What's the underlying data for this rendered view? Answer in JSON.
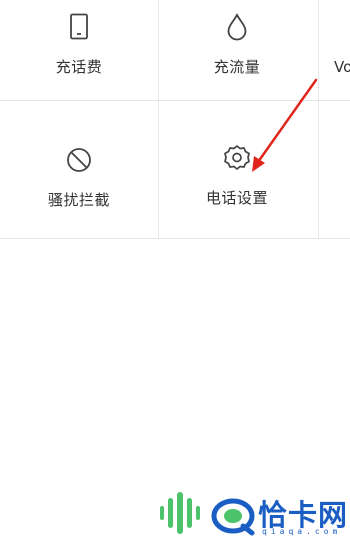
{
  "grid": {
    "row1": [
      {
        "label": "充话费",
        "icon": "phone-outline-icon"
      },
      {
        "label": "充流量",
        "icon": "droplet-icon"
      },
      {
        "label": "Vo",
        "icon": ""
      }
    ],
    "row2": [
      {
        "label": "骚扰拦截",
        "icon": "block-icon"
      },
      {
        "label": "电话设置",
        "icon": "gear-icon"
      }
    ]
  },
  "annotation": {
    "arrow_color": "#e0261c"
  },
  "watermark": {
    "title": "恰卡网",
    "url": "qiaqa.com",
    "brand_color": "#1a5ec4",
    "accent_green": "#4cc36b"
  }
}
